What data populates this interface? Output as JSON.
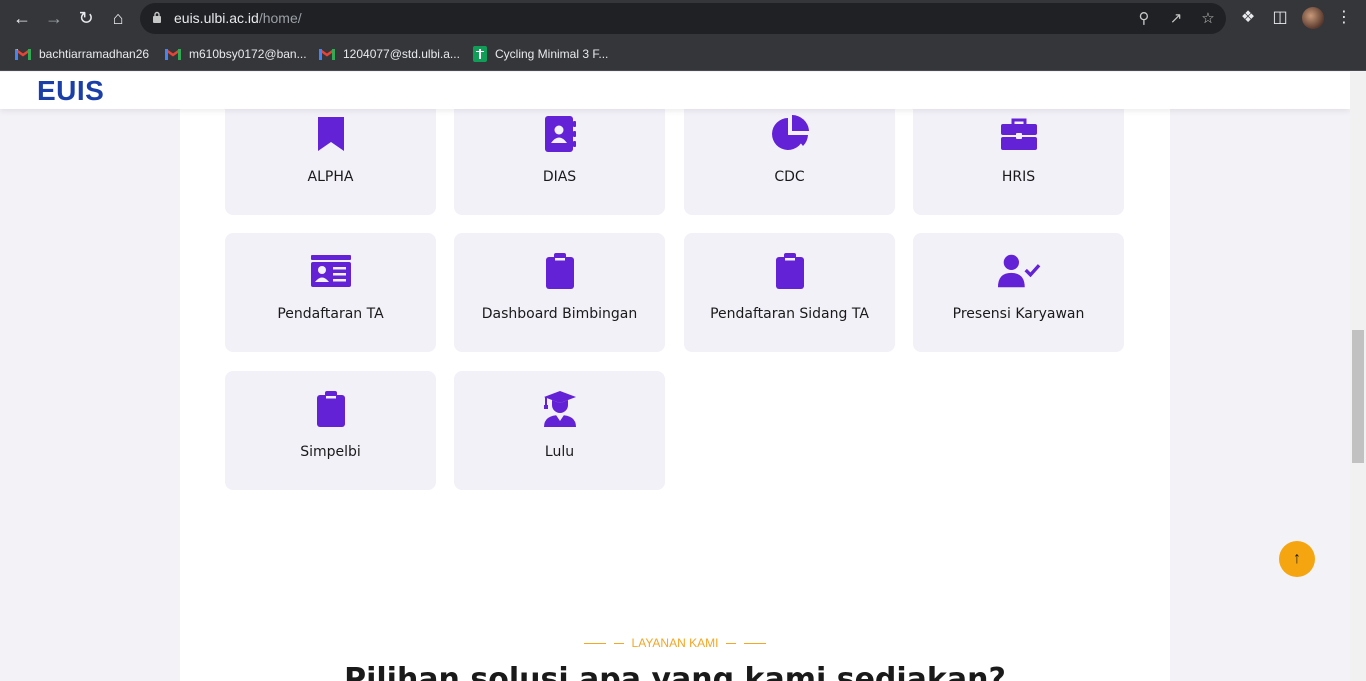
{
  "browser": {
    "url_host": "euis.ulbi.ac.id",
    "url_path": "/home/",
    "bookmarks": [
      {
        "label": "bachtiarramadhan26",
        "icon": "gmail-icon"
      },
      {
        "label": "m610bsy0172@ban...",
        "icon": "gmail-icon"
      },
      {
        "label": "1204077@std.ulbi.a...",
        "icon": "gmail-icon"
      },
      {
        "label": "Cycling Minimal 3 F...",
        "icon": "sheets-icon"
      }
    ]
  },
  "site": {
    "logo": "EUIS",
    "accent_color": "#6322d6",
    "logo_color": "#1b3fa8"
  },
  "apps": [
    {
      "label": "ALPHA",
      "icon": "bookmark-icon"
    },
    {
      "label": "DIAS",
      "icon": "address-book-icon"
    },
    {
      "label": "CDC",
      "icon": "pie-chart-icon"
    },
    {
      "label": "HRIS",
      "icon": "briefcase-icon"
    },
    {
      "label": "Pendaftaran TA",
      "icon": "id-card-icon"
    },
    {
      "label": "Dashboard Bimbingan",
      "icon": "clipboard-icon"
    },
    {
      "label": "Pendaftaran Sidang TA",
      "icon": "clipboard-icon"
    },
    {
      "label": "Presensi Karyawan",
      "icon": "user-check-icon"
    },
    {
      "label": "Simpelbi",
      "icon": "clipboard-icon"
    },
    {
      "label": "Lulu",
      "icon": "graduate-icon"
    }
  ],
  "section": {
    "tag": "LAYANAN KAMI",
    "heading": "Pilihan solusi apa yang kami sediakan?"
  },
  "scroll_top_label": "↑"
}
